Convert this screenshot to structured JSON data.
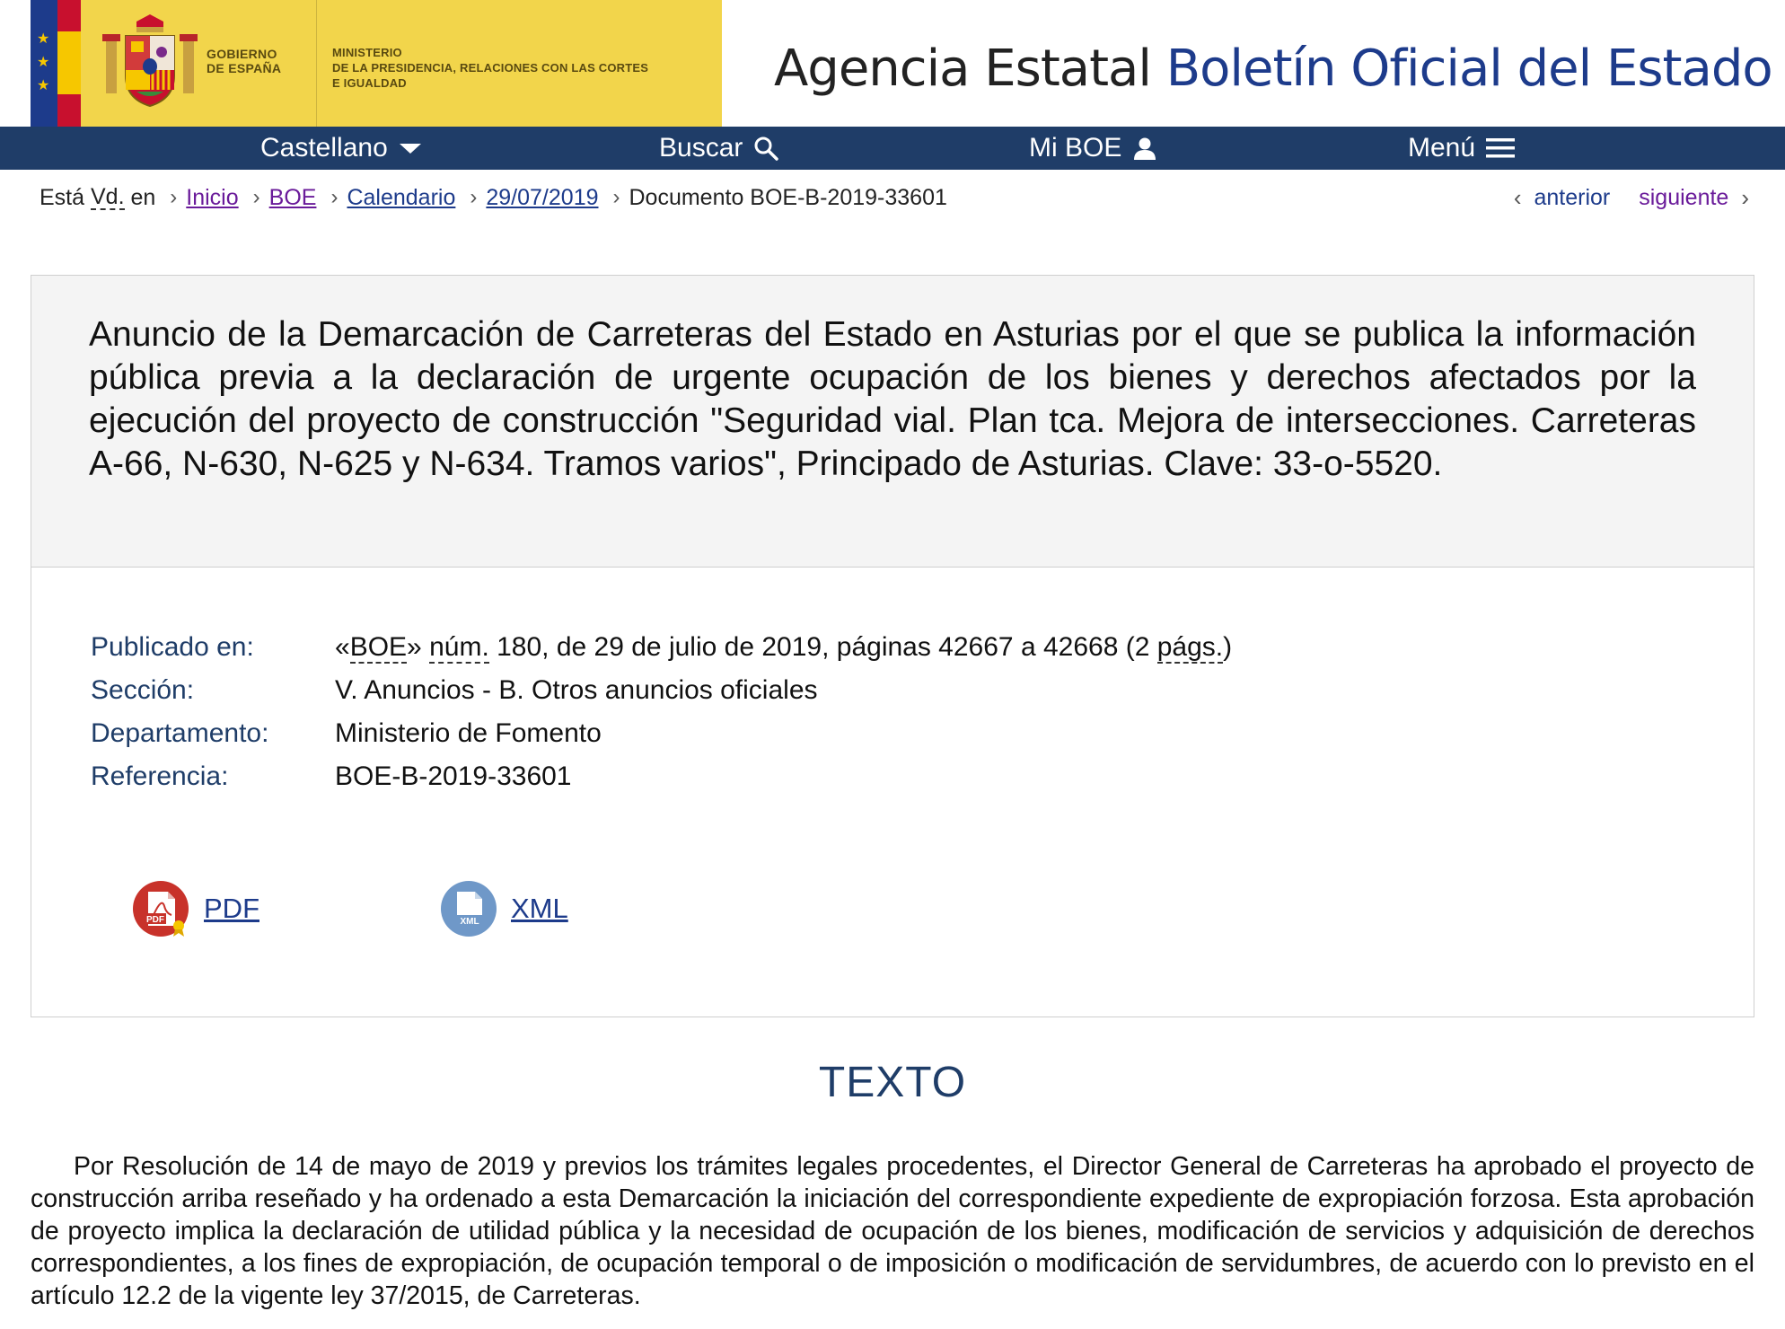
{
  "header": {
    "gov_line1": "GOBIERNO",
    "gov_line2": "DE ESPAÑA",
    "ministry_line1": "MINISTERIO",
    "ministry_line2": "DE LA PRESIDENCIA, RELACIONES CON LAS CORTES",
    "ministry_line3": "E IGUALDAD",
    "site_title_plain": "Agencia Estatal",
    "site_title_highlight": "Boletín Oficial del Estado"
  },
  "nav": {
    "language": "Castellano",
    "search": "Buscar",
    "my_boe": "Mi BOE",
    "menu": "Menú"
  },
  "breadcrumb": {
    "prefix_a": "Está ",
    "prefix_abbr": "Vd.",
    "prefix_b": " en",
    "items": [
      "Inicio",
      "BOE",
      "Calendario",
      "29/07/2019"
    ],
    "current": "Documento BOE-B-2019-33601"
  },
  "pager": {
    "previous": "anterior",
    "next": "siguiente"
  },
  "document": {
    "title": "Anuncio de la Demarcación de Carreteras del Estado en Asturias por el que se publica la información pública previa a la declaración de urgente ocupación de los bienes y derechos afectados por la ejecución del proyecto de construcción \"Seguridad vial. Plan tca. Mejora de intersecciones. Carreteras A-66, N-630, N-625 y N-634. Tramos varios\", Principado de Asturias. Clave: 33-o-5520.",
    "meta": {
      "published_label": "Publicado en:",
      "published_q1": "«",
      "published_boe": "BOE",
      "published_q2": "» ",
      "published_num": "núm.",
      "published_rest": " 180, de 29 de julio de 2019, páginas 42667 a 42668 (2 ",
      "published_pags": "págs.",
      "published_close": ")",
      "section_label": "Sección:",
      "section_value": "V. Anuncios - B. Otros anuncios oficiales",
      "department_label": "Departamento:",
      "department_value": "Ministerio de Fomento",
      "reference_label": "Referencia:",
      "reference_value": "BOE-B-2019-33601"
    },
    "downloads": {
      "pdf": "PDF",
      "pdf_icon_text": "PDF",
      "xml": "XML",
      "xml_icon_text": "XML"
    }
  },
  "texto": {
    "heading": "TEXTO",
    "paragraph": "Por Resolución de 14 de mayo de 2019 y previos los trámites legales procedentes, el Director General de Carreteras ha aprobado el proyecto de construcción arriba reseñado y ha ordenado a esta Demarcación la iniciación del correspondiente expediente de expropiación forzosa. Esta aprobación de proyecto implica la declaración de utilidad pública y la necesidad de ocupación de los bienes, modificación de servicios y adquisición de derechos correspondientes, a los fines de expropiación, de ocupación temporal o de imposición o modificación de servidumbres, de acuerdo con lo previsto en el artículo 12.2 de la vigente ley 37/2015, de Carreteras."
  },
  "colors": {
    "nav_bg": "#1f3d68",
    "gov_yellow": "#f2d54b",
    "link_blue": "#1d3b8b",
    "visited_purple": "#6a1b9a"
  }
}
